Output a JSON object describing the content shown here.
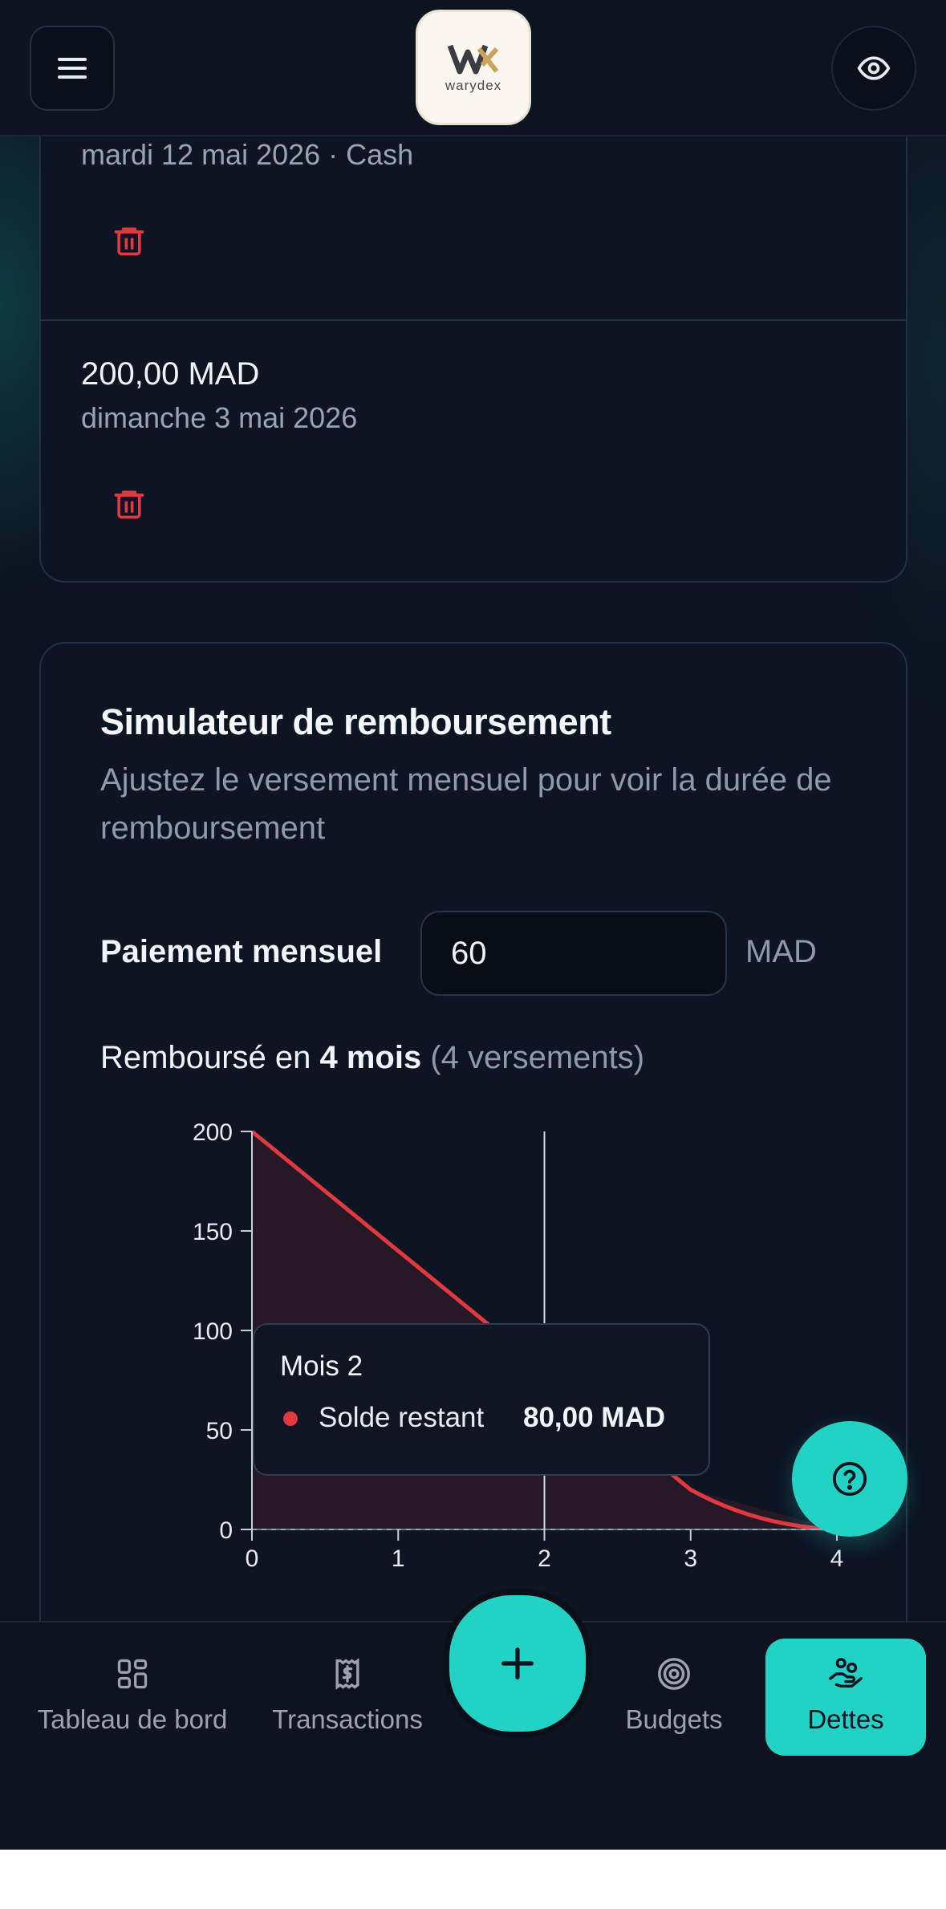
{
  "header": {
    "logo_text": "warydex",
    "icons": {
      "menu": "menu-icon",
      "visibility": "eye-icon"
    }
  },
  "payments": [
    {
      "amount": "",
      "date": "mardi 12 mai 2026 · Cash"
    },
    {
      "amount": "200,00 MAD",
      "date": "dimanche 3 mai 2026"
    }
  ],
  "simulator": {
    "title": "Simulateur de remboursement",
    "subtitle": "Ajustez le versement mensuel pour voir la durée de remboursement",
    "monthly_label": "Paiement mensuel",
    "monthly_value": "60",
    "unit": "MAD",
    "summary_prefix": "Remboursé en",
    "summary_duration": "4 mois",
    "summary_suffix": "(4 versements)",
    "tooltip": {
      "title": "Mois 2",
      "series_name": "Solde restant",
      "value": "80,00 MAD"
    }
  },
  "chart_data": {
    "type": "area",
    "x": [
      0,
      1,
      2,
      3,
      4
    ],
    "series": [
      {
        "name": "Solde restant",
        "values": [
          200,
          140,
          80,
          20,
          0
        ],
        "color": "#e0393f"
      }
    ],
    "ylim": [
      0,
      200
    ],
    "xlim": [
      0,
      4
    ],
    "yticks": [
      "0",
      "50",
      "100",
      "150",
      "200"
    ],
    "xticks": [
      "0",
      "1",
      "2",
      "3",
      "4"
    ],
    "hover_x": 2,
    "grid": false
  },
  "bottom_nav": {
    "items": [
      {
        "label": "Tableau de bord",
        "icon": "dashboard-icon"
      },
      {
        "label": "Transactions",
        "icon": "receipt-icon"
      },
      {
        "label": "Budgets",
        "icon": "target-icon"
      },
      {
        "label": "Dettes",
        "icon": "debt-hand-icon",
        "active": true
      }
    ],
    "fab_icon": "plus-icon"
  },
  "help_icon": "help-icon",
  "colors": {
    "accent": "#22d3c5",
    "danger": "#e0393f",
    "background": "#0b1220"
  }
}
